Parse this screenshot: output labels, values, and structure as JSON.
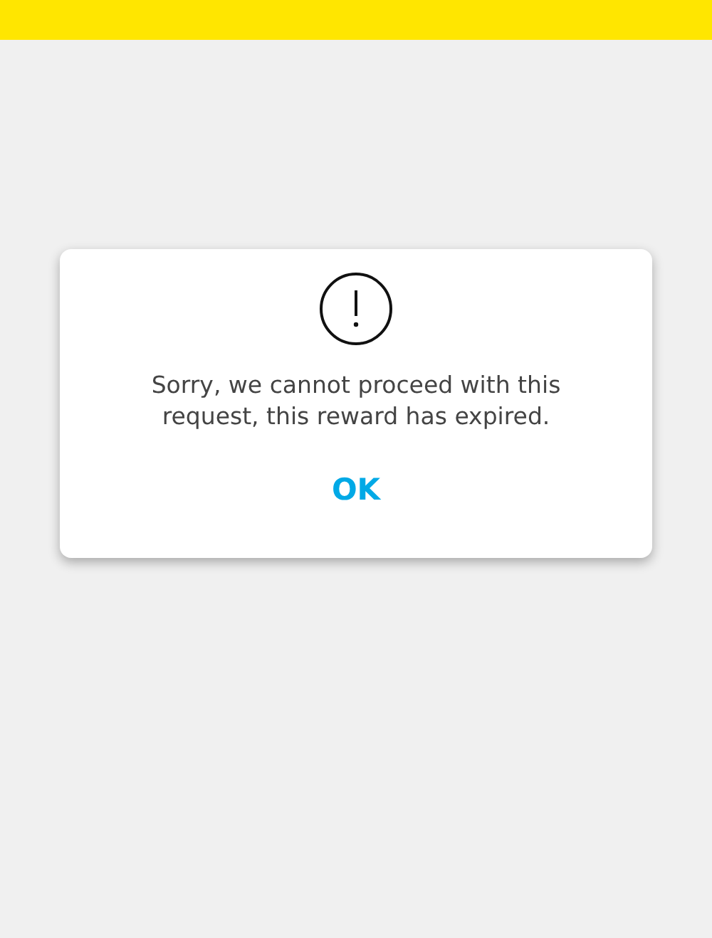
{
  "dialog": {
    "message": "Sorry, we cannot proceed with this request, this reward has expired.",
    "button": "OK"
  }
}
